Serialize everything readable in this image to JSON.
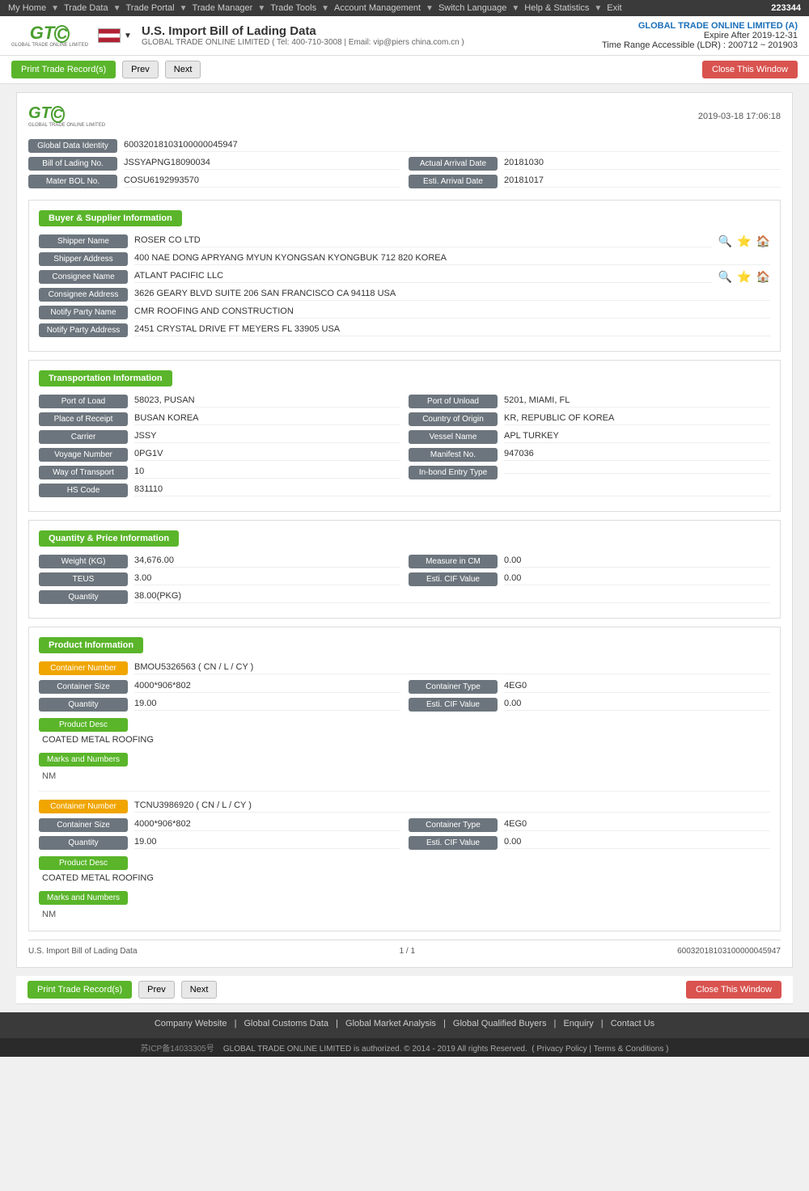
{
  "topnav": {
    "items": [
      "My Home",
      "Trade Data",
      "Trade Portal",
      "Trade Manager",
      "Trade Tools",
      "Account Management",
      "Switch Language",
      "Help & Statistics",
      "Exit"
    ],
    "account": "223344"
  },
  "header": {
    "title": "U.S. Import Bill of Lading Data",
    "subtitle": "GLOBAL TRADE ONLINE LIMITED ( Tel: 400-710-3008 | Email: vip@piers china.com.cn )",
    "company": "GLOBAL TRADE ONLINE LIMITED (A)",
    "expire": "Expire After 2019-12-31",
    "timerange": "Time Range Accessible (LDR) : 200712 ~ 201903"
  },
  "toolbar": {
    "print_label": "Print Trade Record(s)",
    "prev_label": "Prev",
    "next_label": "Next",
    "close_label": "Close This Window"
  },
  "card": {
    "logo_main": "GTC",
    "logo_sub": "GLOBAL TRADE ONLINE LIMITED",
    "date": "2019-03-18 17:06:18",
    "global_data_identity_label": "Global Data Identity",
    "global_data_identity": "60032018103100000045947",
    "bol_no_label": "Bill of Lading No.",
    "bol_no": "JSSYAPNG18090034",
    "actual_arrival_label": "Actual Arrival Date",
    "actual_arrival": "20181030",
    "mater_bol_label": "Mater BOL No.",
    "mater_bol": "COSU6192993570",
    "esti_arrival_label": "Esti. Arrival Date",
    "esti_arrival": "20181017"
  },
  "buyer_supplier": {
    "section_label": "Buyer & Supplier Information",
    "shipper_name_label": "Shipper Name",
    "shipper_name": "ROSER CO LTD",
    "shipper_address_label": "Shipper Address",
    "shipper_address": "400 NAE DONG APRYANG MYUN KYONGSAN KYONGBUK 712 820 KOREA",
    "consignee_name_label": "Consignee Name",
    "consignee_name": "ATLANT PACIFIC LLC",
    "consignee_address_label": "Consignee Address",
    "consignee_address": "3626 GEARY BLVD SUITE 206 SAN FRANCISCO CA 94118 USA",
    "notify_party_name_label": "Notify Party Name",
    "notify_party_name": "CMR ROOFING AND CONSTRUCTION",
    "notify_party_address_label": "Notify Party Address",
    "notify_party_address": "2451 CRYSTAL DRIVE FT MEYERS FL 33905 USA"
  },
  "transportation": {
    "section_label": "Transportation Information",
    "port_of_load_label": "Port of Load",
    "port_of_load": "58023, PUSAN",
    "port_of_unload_label": "Port of Unload",
    "port_of_unload": "5201, MIAMI, FL",
    "place_of_receipt_label": "Place of Receipt",
    "place_of_receipt": "BUSAN KOREA",
    "country_of_origin_label": "Country of Origin",
    "country_of_origin": "KR, REPUBLIC OF KOREA",
    "carrier_label": "Carrier",
    "carrier": "JSSY",
    "vessel_name_label": "Vessel Name",
    "vessel_name": "APL TURKEY",
    "voyage_number_label": "Voyage Number",
    "voyage_number": "0PG1V",
    "manifest_no_label": "Manifest No.",
    "manifest_no": "947036",
    "way_of_transport_label": "Way of Transport",
    "way_of_transport": "10",
    "inbond_entry_type_label": "In-bond Entry Type",
    "inbond_entry_type": "",
    "hs_code_label": "HS Code",
    "hs_code": "831110"
  },
  "quantity_price": {
    "section_label": "Quantity & Price Information",
    "weight_label": "Weight (KG)",
    "weight": "34,676.00",
    "measure_cm_label": "Measure in CM",
    "measure_cm": "0.00",
    "teus_label": "TEUS",
    "teus": "3.00",
    "esti_cif_label": "Esti. CIF Value",
    "esti_cif": "0.00",
    "quantity_label": "Quantity",
    "quantity": "38.00(PKG)"
  },
  "product_info": {
    "section_label": "Product Information",
    "containers": [
      {
        "container_number_label": "Container Number",
        "container_number": "BMOU5326563 ( CN / L / CY )",
        "container_size_label": "Container Size",
        "container_size": "4000*906*802",
        "container_type_label": "Container Type",
        "container_type": "4EG0",
        "quantity_label": "Quantity",
        "quantity": "19.00",
        "esti_cif_label": "Esti. CIF Value",
        "esti_cif": "0.00",
        "product_desc_label": "Product Desc",
        "product_desc": "COATED METAL ROOFING",
        "marks_label": "Marks and Numbers",
        "marks": "NM"
      },
      {
        "container_number_label": "Container Number",
        "container_number": "TCNU3986920 ( CN / L / CY )",
        "container_size_label": "Container Size",
        "container_size": "4000*906*802",
        "container_type_label": "Container Type",
        "container_type": "4EG0",
        "quantity_label": "Quantity",
        "quantity": "19.00",
        "esti_cif_label": "Esti. CIF Value",
        "esti_cif": "0.00",
        "product_desc_label": "Product Desc",
        "product_desc": "COATED METAL ROOFING",
        "marks_label": "Marks and Numbers",
        "marks": "NM"
      }
    ]
  },
  "doc_footer": {
    "left": "U.S. Import Bill of Lading Data",
    "center": "1 / 1",
    "right": "60032018103100000045947"
  },
  "bottom_links": {
    "items": [
      "Company Website",
      "Global Customs Data",
      "Global Market Analysis",
      "Global Qualified Buyers",
      "Enquiry",
      "Contact Us"
    ]
  },
  "bottom_footer": {
    "text": "GLOBAL TRADE ONLINE LIMITED is authorized. © 2014 - 2019 All rights Reserved.",
    "privacy": "Privacy Policy",
    "terms": "Terms & Conditions",
    "icp": "苏ICP备14033305号"
  }
}
